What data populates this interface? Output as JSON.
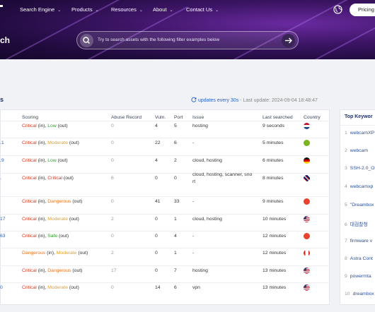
{
  "nav": {
    "items": [
      "Search Engine",
      "Products",
      "Resources",
      "About",
      "Contact Us"
    ],
    "pricing_label": "Pricing"
  },
  "hero": {
    "title_fragment": "ch",
    "search_placeholder": "Try to search assets with the following filter examples below"
  },
  "section": {
    "title_fragment": "s",
    "updates_label": "updates every 30s",
    "last_update": "- Last update: 2024-09-04 18:48:47"
  },
  "table": {
    "headers": [
      "Scoring",
      "Abuse Record",
      "Vuln.",
      "Port",
      "Issue",
      "Last searched",
      "Country"
    ],
    "rows": [
      {
        "ip": "",
        "s1": "Critical",
        "s2": "Low",
        "abuse": "0",
        "vuln": "4",
        "port": "5",
        "issue": "hosting",
        "last": "9 seconds",
        "flag": "nl"
      },
      {
        "ip": ".1",
        "s1": "Critical",
        "s2": "Moderate",
        "abuse": "0",
        "vuln": "22",
        "port": "6",
        "issue": "-",
        "last": "5 minutes",
        "flag": "green"
      },
      {
        "ip": ".9",
        "s1": "Critical",
        "s2": "Low",
        "abuse": "0",
        "vuln": "4",
        "port": "2",
        "issue": "cloud, hosting",
        "last": "6 minutes",
        "flag": "de"
      },
      {
        "ip": ".",
        "s1": "Critical",
        "s2": "Critical",
        "abuse": "6",
        "vuln": "0",
        "port": "0",
        "issue": "cloud, hosting, scanner, sno",
        "issue2": "rt",
        "last": "8 minutes",
        "flag": "gb"
      },
      {
        "ip": "",
        "s1": "Critical",
        "s2": "Dangerous",
        "abuse": "0",
        "vuln": "41",
        "port": "33",
        "issue": "-",
        "last": "9 minutes",
        "flag": "red"
      },
      {
        "ip": "17",
        "s1": "Critical",
        "s2": "Moderate",
        "abuse": "2",
        "vuln": "0",
        "port": "1",
        "issue": "cloud, hosting",
        "last": "10 minutes",
        "flag": "us"
      },
      {
        "ip": "63",
        "s1": "Critical",
        "s2": "Safe",
        "abuse": "0",
        "vuln": "0",
        "port": "4",
        "issue": "-",
        "last": "12 minutes",
        "flag": "red"
      },
      {
        "ip": "",
        "s1": "Dangerous",
        "s2": "Moderate",
        "abuse": "2",
        "vuln": "0",
        "port": "1",
        "issue": "-",
        "last": "12 minutes",
        "flag": "ca"
      },
      {
        "ip": "",
        "s1": "Critical",
        "s2": "Dangerous",
        "abuse": "17",
        "vuln": "0",
        "port": "7",
        "issue": "hosting",
        "last": "13 minutes",
        "flag": "us"
      },
      {
        "ip": "0",
        "s1": "Critical",
        "s2": "Moderate",
        "abuse": "0",
        "vuln": "14",
        "port": "6",
        "issue": "vpn",
        "last": "13 minutes",
        "flag": "us"
      }
    ]
  },
  "keywords": {
    "title": "Top Keywor",
    "items": [
      {
        "n": "1",
        "text": "webcamXP"
      },
      {
        "n": "2",
        "text": "webcam"
      },
      {
        "n": "3",
        "text": "SSH-2.0_Op"
      },
      {
        "n": "4",
        "text": "webcamxp"
      },
      {
        "n": "5",
        "text": "\"Dreambox"
      },
      {
        "n": "6",
        "text": "대검찰청"
      },
      {
        "n": "7",
        "text": "firmware v"
      },
      {
        "n": "8",
        "text": "Astra Cont"
      },
      {
        "n": "9",
        "text": "powermta"
      },
      {
        "n": "10",
        "text": "dreambox"
      }
    ]
  },
  "colors": {
    "critical": "#d9371e",
    "low": "#2f9e2f",
    "moderate": "#e6a01e",
    "dangerous": "#e8731c",
    "safe": "#2f9e2f",
    "link": "#2a63c8"
  }
}
